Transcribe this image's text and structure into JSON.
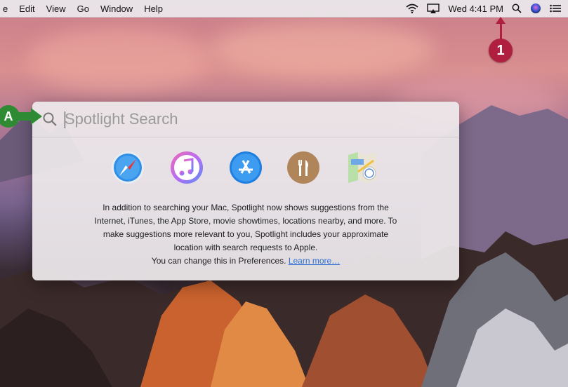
{
  "menubar": {
    "items": [
      "e",
      "Edit",
      "View",
      "Go",
      "Window",
      "Help"
    ],
    "clock": "Wed 4:41 PM",
    "icons": [
      "wifi-icon",
      "airplay-icon",
      "spotlight-search-icon",
      "siri-icon",
      "notification-center-icon"
    ]
  },
  "callouts": {
    "step_1": "1",
    "step_a": "A"
  },
  "spotlight": {
    "placeholder": "Spotlight Search",
    "suggestion_icons": [
      "safari-icon",
      "itunes-icon",
      "app-store-icon",
      "restaurants-icon",
      "maps-icon"
    ],
    "info_lines": [
      "In addition to searching your Mac, Spotlight now shows suggestions from the",
      "Internet, iTunes, the App Store, movie showtimes, locations nearby, and more. To",
      "make suggestions more relevant to you, Spotlight includes your approximate",
      "location with search requests to Apple."
    ],
    "prefs_text": "You can change this in Preferences.",
    "learn_more": "Learn more…"
  },
  "colors": {
    "callout_red": "#b01f3f",
    "callout_green": "#2e8b34",
    "link": "#2b6fd6"
  }
}
